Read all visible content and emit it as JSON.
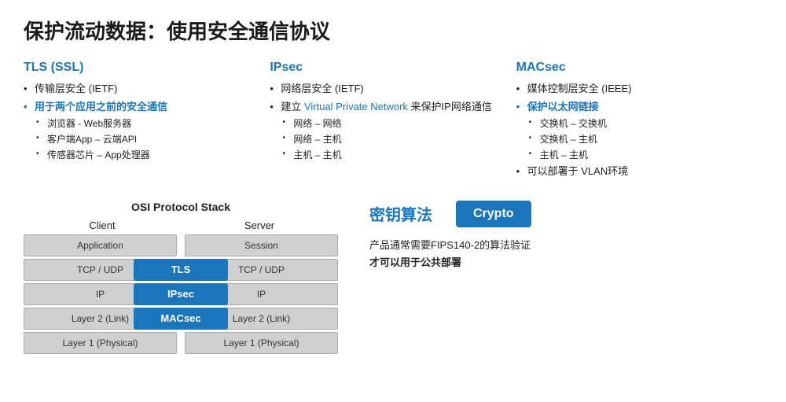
{
  "page": {
    "title": "保护流动数据：使用安全通信协议"
  },
  "tls": {
    "heading": "TLS (SSL)",
    "bullets": [
      {
        "text": "传输层安全 (IETF)",
        "highlight": false
      },
      {
        "text": "用于两个应用之前的安全通信",
        "highlight": true
      },
      {
        "text": "浏览器 - Web服务器",
        "sub": true
      },
      {
        "text": "客户端App – 云端API",
        "sub": true
      },
      {
        "text": "传感器芯片 – App处理器",
        "sub": true
      }
    ]
  },
  "ipsec": {
    "heading": "IPsec",
    "bullets": [
      {
        "text": "网络层安全 (IETF)",
        "highlight": false
      },
      {
        "text": "建立",
        "linkText": "Virtual Private Network",
        "suffix": " 来保护IP网络通信",
        "highlight": false
      },
      {
        "text": "网络 – 网络",
        "sub": true
      },
      {
        "text": "网络 – 主机",
        "sub": true
      },
      {
        "text": "主机 – 主机",
        "sub": true
      }
    ]
  },
  "macsec": {
    "heading": "MACsec",
    "bullets": [
      {
        "text": "媒体控制层安全 (IEEE)",
        "highlight": false
      },
      {
        "text": "保护以太网链接",
        "highlight": true
      },
      {
        "text": "交换机 – 交换机",
        "sub": true
      },
      {
        "text": "交换机 – 主机",
        "sub": true
      },
      {
        "text": "主机 – 主机",
        "sub": true
      },
      {
        "text": "可以部署于 VLAN环境",
        "highlight": false
      }
    ]
  },
  "osi": {
    "title": "OSI  Protocol Stack",
    "client_label": "Client",
    "server_label": "Server",
    "rows": [
      {
        "client": "Application",
        "protocol": null,
        "server": "Session"
      },
      {
        "client": "TCP / UDP",
        "protocol": "TLS",
        "server": "TCP / UDP"
      },
      {
        "client": "IP",
        "protocol": "IPsec",
        "server": "IP"
      },
      {
        "client": "Layer 2 (Link)",
        "protocol": "MACsec",
        "server": "Layer 2 (Link)"
      },
      {
        "client": "Layer 1 (Physical)",
        "protocol": null,
        "server": "Layer 1 (Physical)"
      }
    ]
  },
  "crypto": {
    "title": "密钥算法",
    "badge": "Crypto",
    "desc_line1": "产品通常需要FIPS140-2的算法验证",
    "desc_line2": "才可以用于公共部署"
  }
}
